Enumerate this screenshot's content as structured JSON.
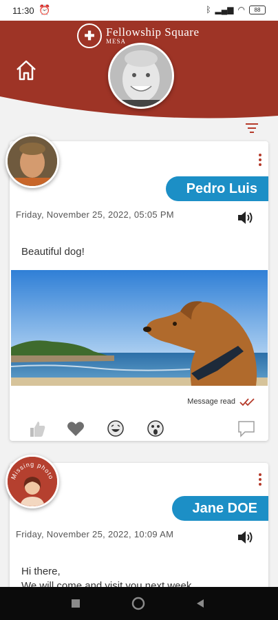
{
  "status_bar": {
    "time": "11:30",
    "battery": "88"
  },
  "header": {
    "brand_name": "Fellowship Square",
    "brand_sub": "MESA",
    "color": "#9e3426"
  },
  "posts": [
    {
      "author": "Pedro Luis",
      "timestamp": "Friday, November 25, 2022, 05:05 PM",
      "message": "Beautiful dog!",
      "read_status": "Message read",
      "has_photo": true
    },
    {
      "author": "Jane DOE",
      "avatar_label": "Missing photo",
      "timestamp": "Friday, November 25, 2022, 10:09 AM",
      "message_lines": [
        "Hi there,",
        "We will come and visit you next week"
      ]
    }
  ],
  "icons": {
    "home": "home-icon",
    "filter": "filter-icon",
    "menu": "kebab-menu-icon",
    "speaker": "speaker-icon",
    "reactions": [
      "thumbs-up-icon",
      "heart-icon",
      "laughing-face-icon",
      "surprised-face-icon",
      "comment-icon"
    ]
  },
  "colors": {
    "accent": "#1c8fc6",
    "brand": "#9e3426",
    "read_check": "#b53a2a"
  }
}
